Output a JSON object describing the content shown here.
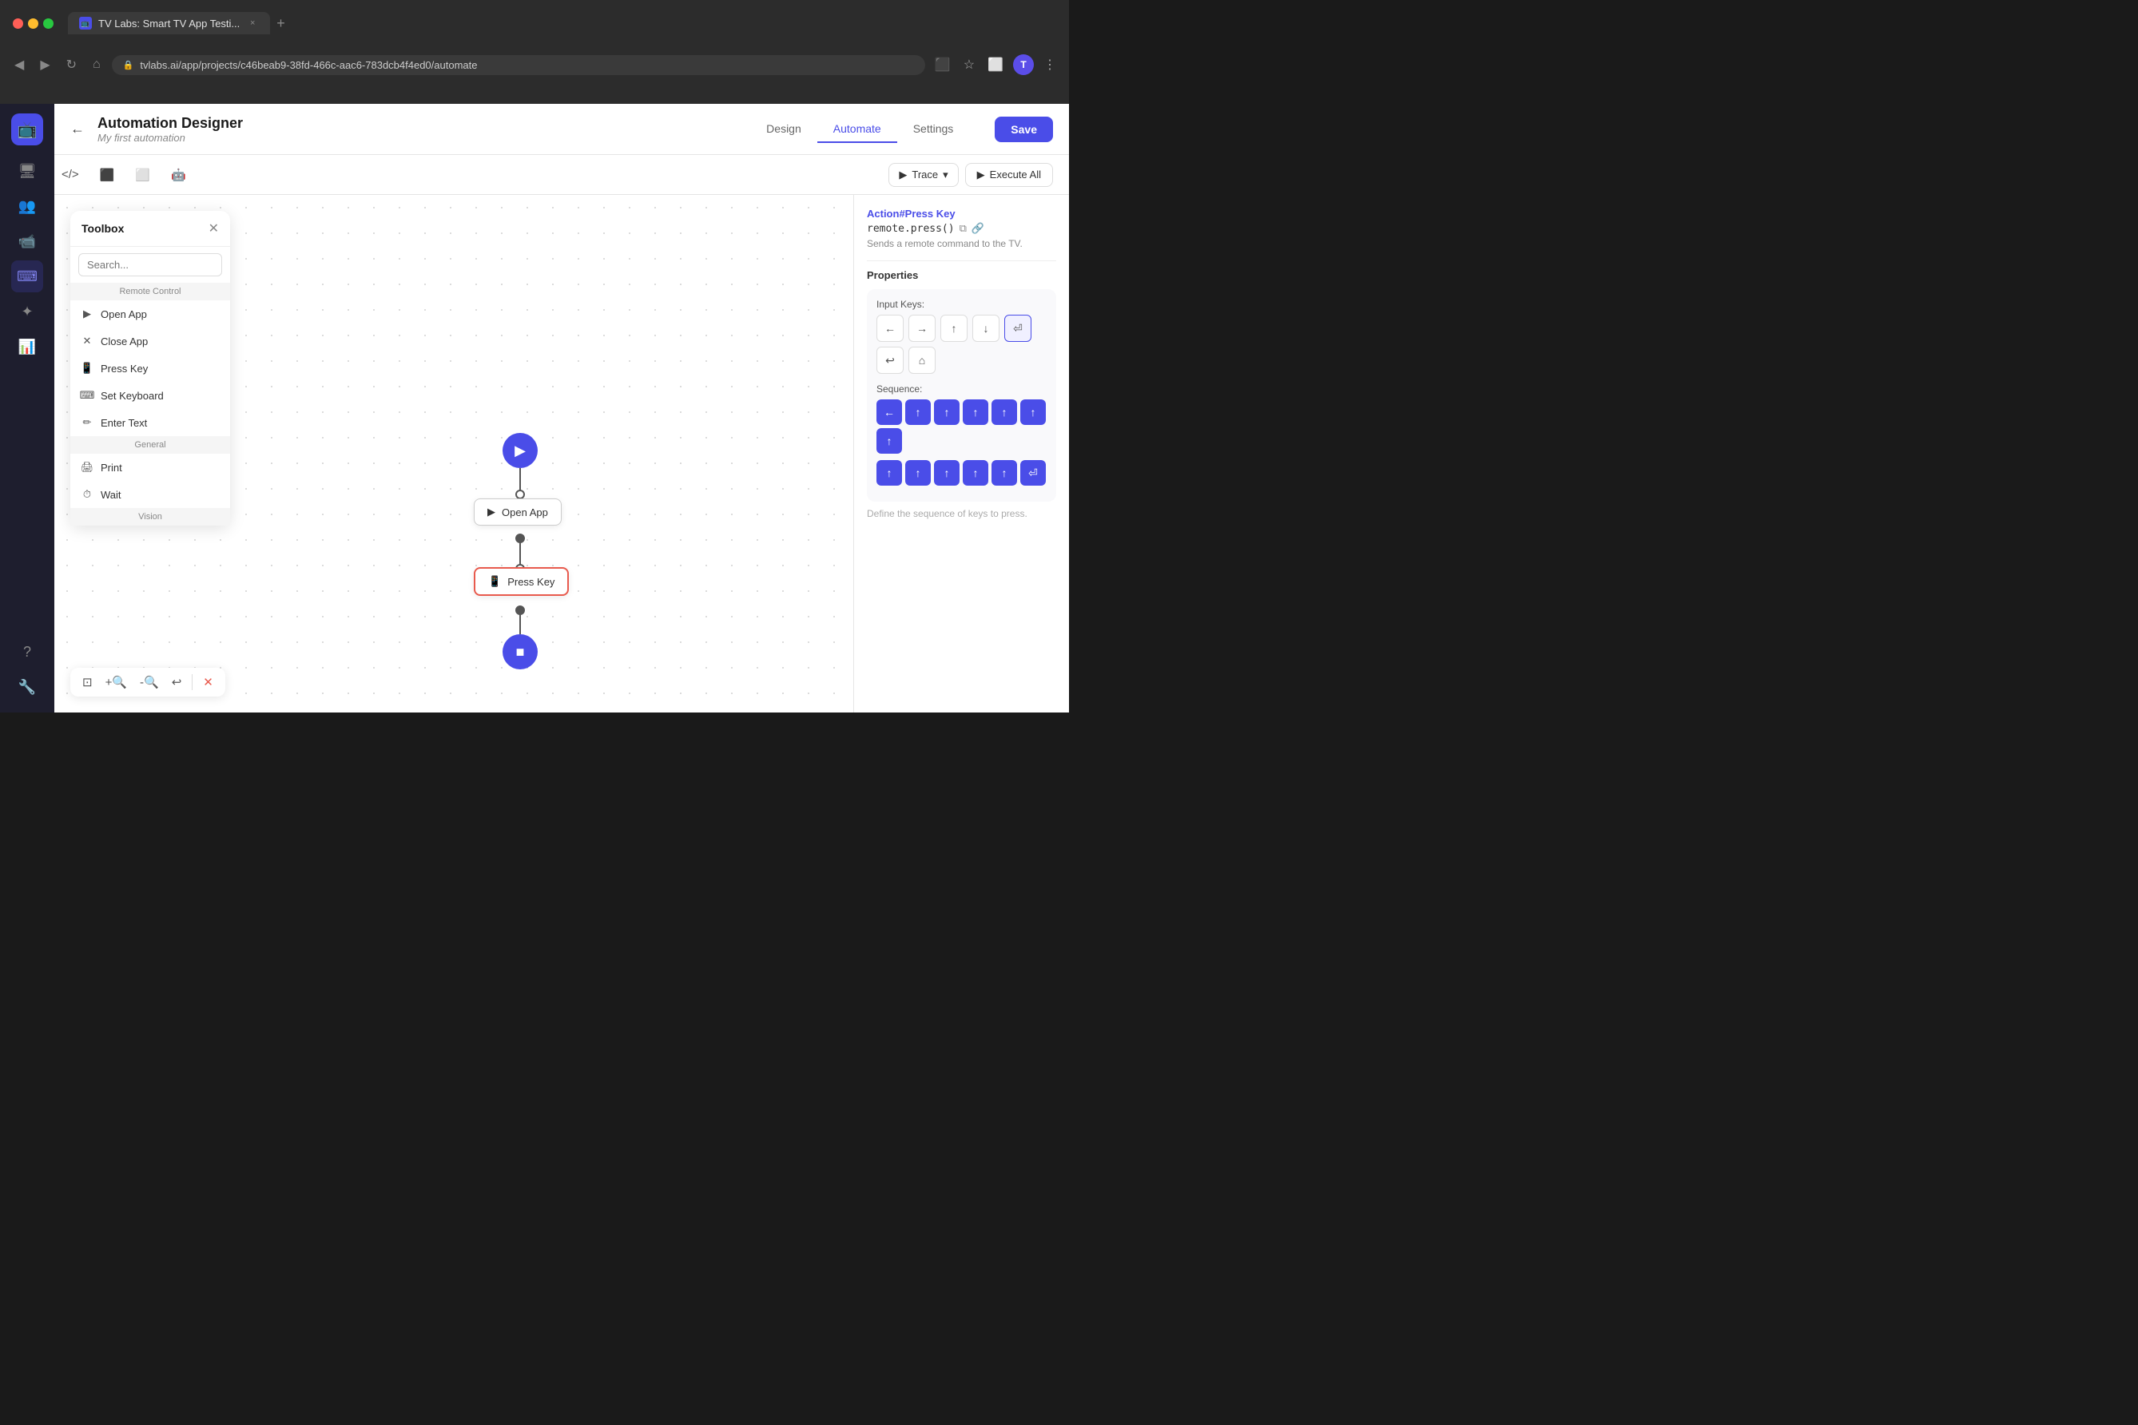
{
  "browser": {
    "tab_title": "TV Labs: Smart TV App Testi...",
    "url": "tvlabs.ai/app/projects/c46beab9-38fd-466c-aac6-783dcb4f4ed0/automate",
    "user_initial": "T",
    "tab_close": "×",
    "tab_add": "+"
  },
  "header": {
    "back_label": "←",
    "title": "Automation Designer",
    "subtitle": "My first automation",
    "tabs": [
      "Design",
      "Automate",
      "Settings"
    ],
    "active_tab": "Automate",
    "save_label": "Save"
  },
  "toolbar": {
    "code_icon": "</>",
    "split_h_icon": "⬛",
    "split_v_icon": "⬛",
    "robot_icon": "🤖",
    "trace_label": "Trace",
    "execute_label": "Execute All"
  },
  "toolbox": {
    "title": "Toolbox",
    "search_placeholder": "Search...",
    "section_remote": "Remote Control",
    "items_remote": [
      {
        "icon": "▶",
        "label": "Open App"
      },
      {
        "icon": "✕",
        "label": "Close App"
      },
      {
        "icon": "📱",
        "label": "Press Key"
      },
      {
        "icon": "⌨",
        "label": "Set Keyboard"
      },
      {
        "icon": "✏",
        "label": "Enter Text"
      }
    ],
    "section_general": "General",
    "items_general": [
      {
        "icon": "🖨",
        "label": "Print"
      },
      {
        "icon": "⏱",
        "label": "Wait"
      }
    ],
    "section_vision": "Vision"
  },
  "canvas": {
    "start_node": "▶",
    "open_app_label": "Open App",
    "press_key_label": "Press Key",
    "end_node": "■"
  },
  "properties": {
    "action_prefix": "Action",
    "action_name": "#Press Key",
    "code": "remote.press()",
    "description": "Sends a remote command to the TV.",
    "section_title": "Properties",
    "input_keys_label": "Input Keys:",
    "keys": [
      "←",
      "→",
      "↑",
      "↓",
      "⏎",
      "↩",
      "⌂"
    ],
    "active_key_index": 4,
    "sequence_label": "Sequence:",
    "sequence_keys": [
      "←",
      "↑",
      "↑",
      "↑",
      "↑",
      "↑",
      "↑",
      "↑",
      "↑",
      "↑",
      "↑",
      "↑",
      "⏎"
    ],
    "hint": "Define the sequence of keys to press."
  },
  "bottom_toolbar": {
    "fit_icon": "⊡",
    "zoom_in_icon": "🔍+",
    "zoom_out_icon": "🔍-",
    "undo_icon": "↩",
    "clear_icon": "✕"
  }
}
